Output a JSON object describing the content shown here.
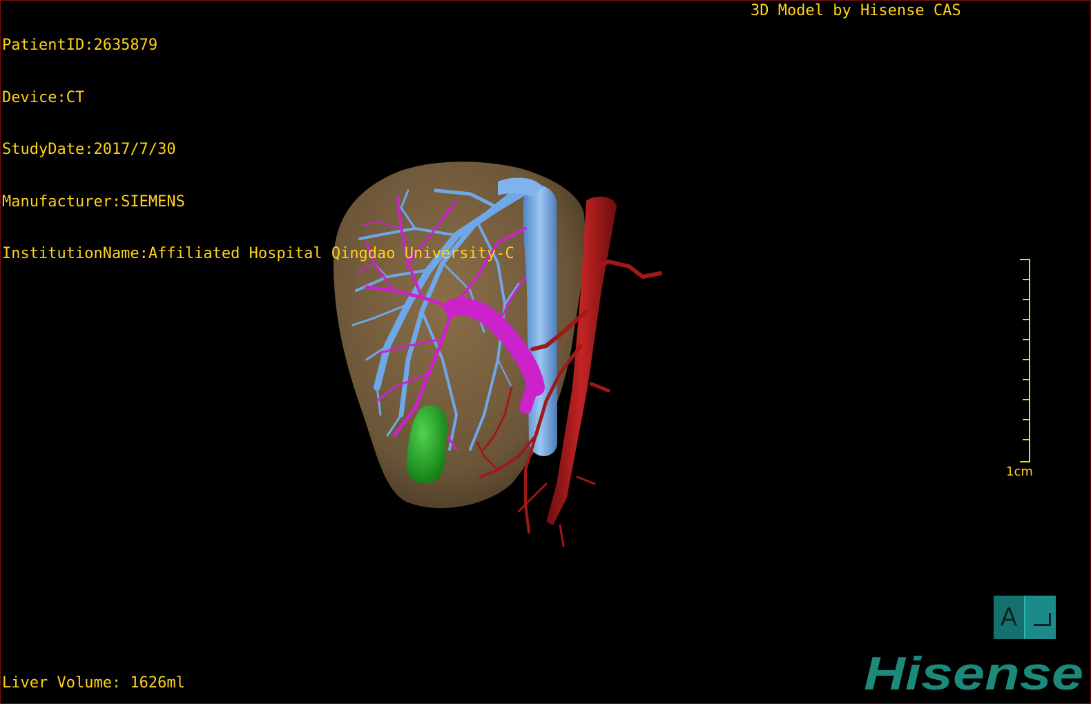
{
  "dicom": {
    "patient_id": "PatientID:2635879",
    "device": "Device:CT",
    "study_date": "StudyDate:2017/7/30",
    "manufacturer": "Manufacturer:SIEMENS",
    "institution": "InstitutionName:Affiliated Hospital Qingdao University-C"
  },
  "credit": "3D Model by Hisense CAS",
  "liver_volume": "Liver Volume: 1626ml",
  "scale": {
    "label": "1cm",
    "color": "#ffd21a"
  },
  "orientation": {
    "label": "A",
    "color": "#1c8a88"
  },
  "brand": {
    "name": "Hisense",
    "color": "#1c8a7a"
  },
  "colors": {
    "text": "#ffd21a",
    "liver": "#6b5538",
    "hepatic_vein": "#6fa8e8",
    "portal_vein": "#cc22cc",
    "artery": "#a01818",
    "gallbladder": "#1fa51f",
    "frame": "#7a1010"
  }
}
